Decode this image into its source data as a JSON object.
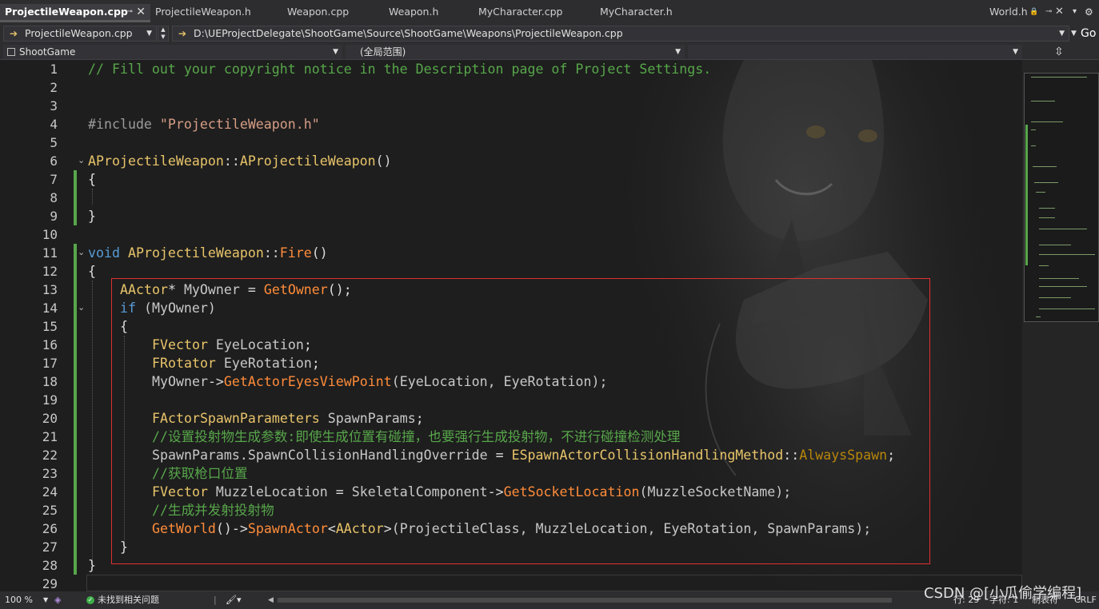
{
  "tabs": [
    {
      "label": "ProjectileWeapon.cpp",
      "active": true,
      "pin": "⊸",
      "close": "✕"
    },
    {
      "label": "ProjectileWeapon.h"
    },
    {
      "label": "Weapon.cpp"
    },
    {
      "label": "Weapon.h"
    },
    {
      "label": "MyCharacter.cpp"
    },
    {
      "label": "MyCharacter.h"
    }
  ],
  "right_tab": {
    "label": "World.h",
    "lock": "🔒",
    "pin": "⊸",
    "close": "✕"
  },
  "window_controls": {
    "dropdown": "▾",
    "settings": "⚙"
  },
  "navbar": {
    "file_combo": "ProjectileWeapon.cpp",
    "path_combo": "D:\\UEProjectDelegate\\ShootGame\\Source\\ShootGame\\Weapons\\ProjectileWeapon.cpp",
    "go_label": "Go"
  },
  "scopebar": {
    "project": "ShootGame",
    "scope": "(全局范围)",
    "split_icon": "⇳"
  },
  "line_numbers": [
    "1",
    "2",
    "3",
    "4",
    "5",
    "6",
    "7",
    "8",
    "9",
    "10",
    "11",
    "12",
    "13",
    "14",
    "15",
    "16",
    "17",
    "18",
    "19",
    "20",
    "21",
    "22",
    "23",
    "24",
    "25",
    "26",
    "27",
    "28",
    "29"
  ],
  "code": {
    "l1": "// Fill out your copyright notice in the Description page of Project Settings.",
    "l4_pre": "#include ",
    "l4_str": "\"ProjectileWeapon.h\"",
    "l6_cls": "AProjectileWeapon",
    "l6_sep": "::",
    "l6_fn": "AProjectileWeapon",
    "l6_par": "()",
    "brace_open": "{",
    "brace_close": "}",
    "l11_kw": "void",
    "l11_cls": "AProjectileWeapon",
    "l11_sep": "::",
    "l11_fn": "Fire",
    "l11_par": "()",
    "l13_type": "AActor",
    "l13_rest1": "* ",
    "l13_var": "MyOwner",
    "l13_eq": " = ",
    "l13_fn": "GetOwner",
    "l13_end": "();",
    "l14_kw": "if",
    "l14_rest": " (MyOwner)",
    "l16_type": "FVector",
    "l16_var": " EyeLocation",
    "l16_end": ";",
    "l17_type": "FRotator",
    "l17_var": " EyeRotation",
    "l17_end": ";",
    "l18_var": "MyOwner",
    "l18_arrow": "->",
    "l18_fn": "GetActorEyesViewPoint",
    "l18_args": "(EyeLocation, EyeRotation);",
    "l20_type": "FActorSpawnParameters",
    "l20_var": " SpawnParams",
    "l20_end": ";",
    "l21_comment": "//设置投射物生成参数:即使生成位置有碰撞，也要强行生成投射物，不进行碰撞检测处理",
    "l22_var": "SpawnParams.SpawnCollisionHandlingOverride",
    "l22_eq": " = ",
    "l22_type": "ESpawnActorCollisionHandlingMethod",
    "l22_sep": "::",
    "l22_enum": "AlwaysSpawn",
    "l22_end": ";",
    "l23_comment": "//获取枪口位置",
    "l24_type": "FVector",
    "l24_var": " MuzzleLocation",
    "l24_eq": " = ",
    "l24_var2": "SkeletalComponent",
    "l24_arrow": "->",
    "l24_fn": "GetSocketLocation",
    "l24_args": "(MuzzleSocketName);",
    "l25_comment": "//生成并发射投射物",
    "l26_fn": "GetWorld",
    "l26_p1": "()->",
    "l26_fn2": "SpawnActor",
    "l26_lt": "<",
    "l26_type": "AActor",
    "l26_gt": ">",
    "l26_args": "(ProjectileClass, MuzzleLocation, EyeRotation, SpawnParams);"
  },
  "fold_icon": "⌄",
  "statusbar": {
    "zoom": "100 %",
    "issues": "未找到相关问题",
    "cursor": "行: 29",
    "char": "字符: 1",
    "mode": "制表符",
    "eol": "CRLF"
  },
  "watermark": "CSDN @[小瓜偷学编程]",
  "colors": {
    "comment": "#57a64a",
    "keyword": "#569cd6",
    "type": "#e8c46a",
    "function": "#ff8c3a",
    "string": "#d69d85",
    "enum": "#b8860b",
    "highlight_box": "#e03030",
    "change_bar": "#57a64a"
  }
}
